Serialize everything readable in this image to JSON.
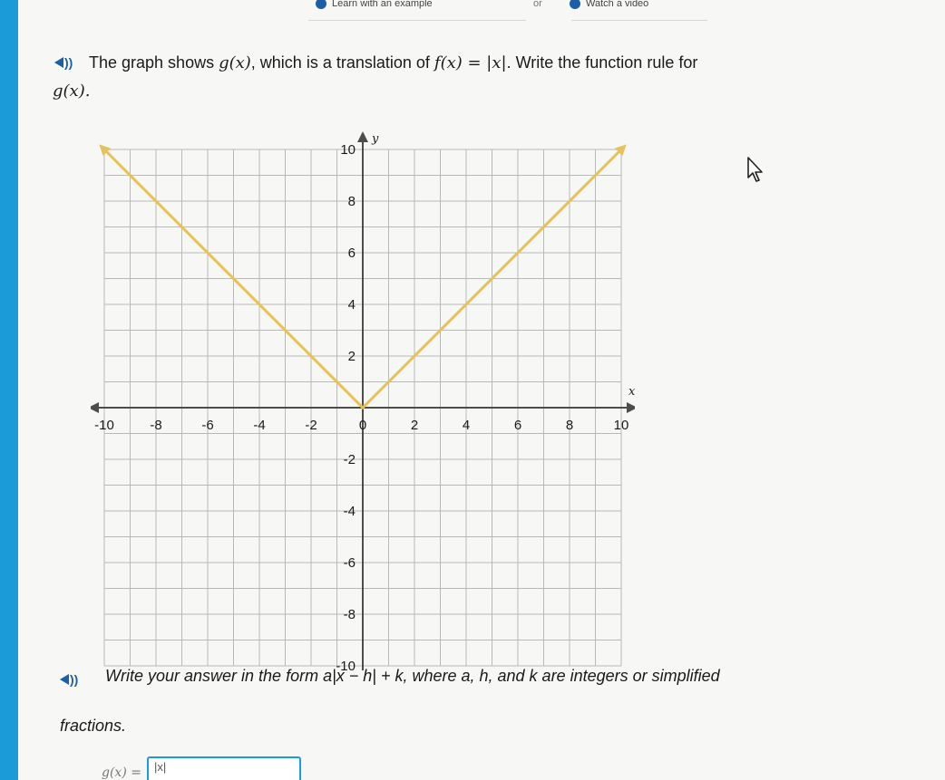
{
  "topbar": {
    "learn_label": "Learn with an example",
    "or_label": "or",
    "watch_label": "Watch a video"
  },
  "question": {
    "intro_part1": "The graph shows ",
    "g_of_x": "g(x)",
    "intro_part2": ", which is a translation of ",
    "f_rule": "f(x) = |x|",
    "intro_part3": ". Write the function rule for",
    "line2": "g(x)."
  },
  "instruction": {
    "line1": "Write your answer in the form a|x − h| + k, where a, h, and k are integers or simplified",
    "line2": "fractions."
  },
  "answer": {
    "prefix": "g(x) =",
    "box_hint": "|x|"
  },
  "colors": {
    "accent": "#1b9bd7",
    "speaker": "#1b5fa8",
    "graph_line": "#e7c25a",
    "grid": "#b9b9b9",
    "axis": "#4d4d4d"
  },
  "icons": {
    "speaker": "speaker-icon",
    "cursor": "mouse-cursor-icon"
  },
  "chart_data": {
    "type": "line",
    "xlim": [
      -10,
      10
    ],
    "ylim": [
      -10,
      10
    ],
    "grid": true,
    "x_axis_name": "x",
    "y_axis_name": "y",
    "x_ticks": [
      -10,
      -8,
      -6,
      -4,
      -2,
      0,
      2,
      4,
      6,
      8,
      10
    ],
    "y_ticks": [
      10,
      8,
      6,
      4,
      2,
      -2,
      -4,
      -6,
      -8,
      -10
    ],
    "x_tick_labels": [
      "-10",
      "-8",
      "-6",
      "-4",
      "-2",
      "0",
      "2",
      "4",
      "6",
      "8",
      "10"
    ],
    "y_tick_labels": [
      "10",
      "8",
      "6",
      "4",
      "2",
      "-2",
      "-4",
      "-6",
      "-8",
      "-10"
    ],
    "series": [
      {
        "x": [
          -10,
          0,
          10
        ],
        "y": [
          10,
          0,
          10
        ]
      }
    ]
  }
}
